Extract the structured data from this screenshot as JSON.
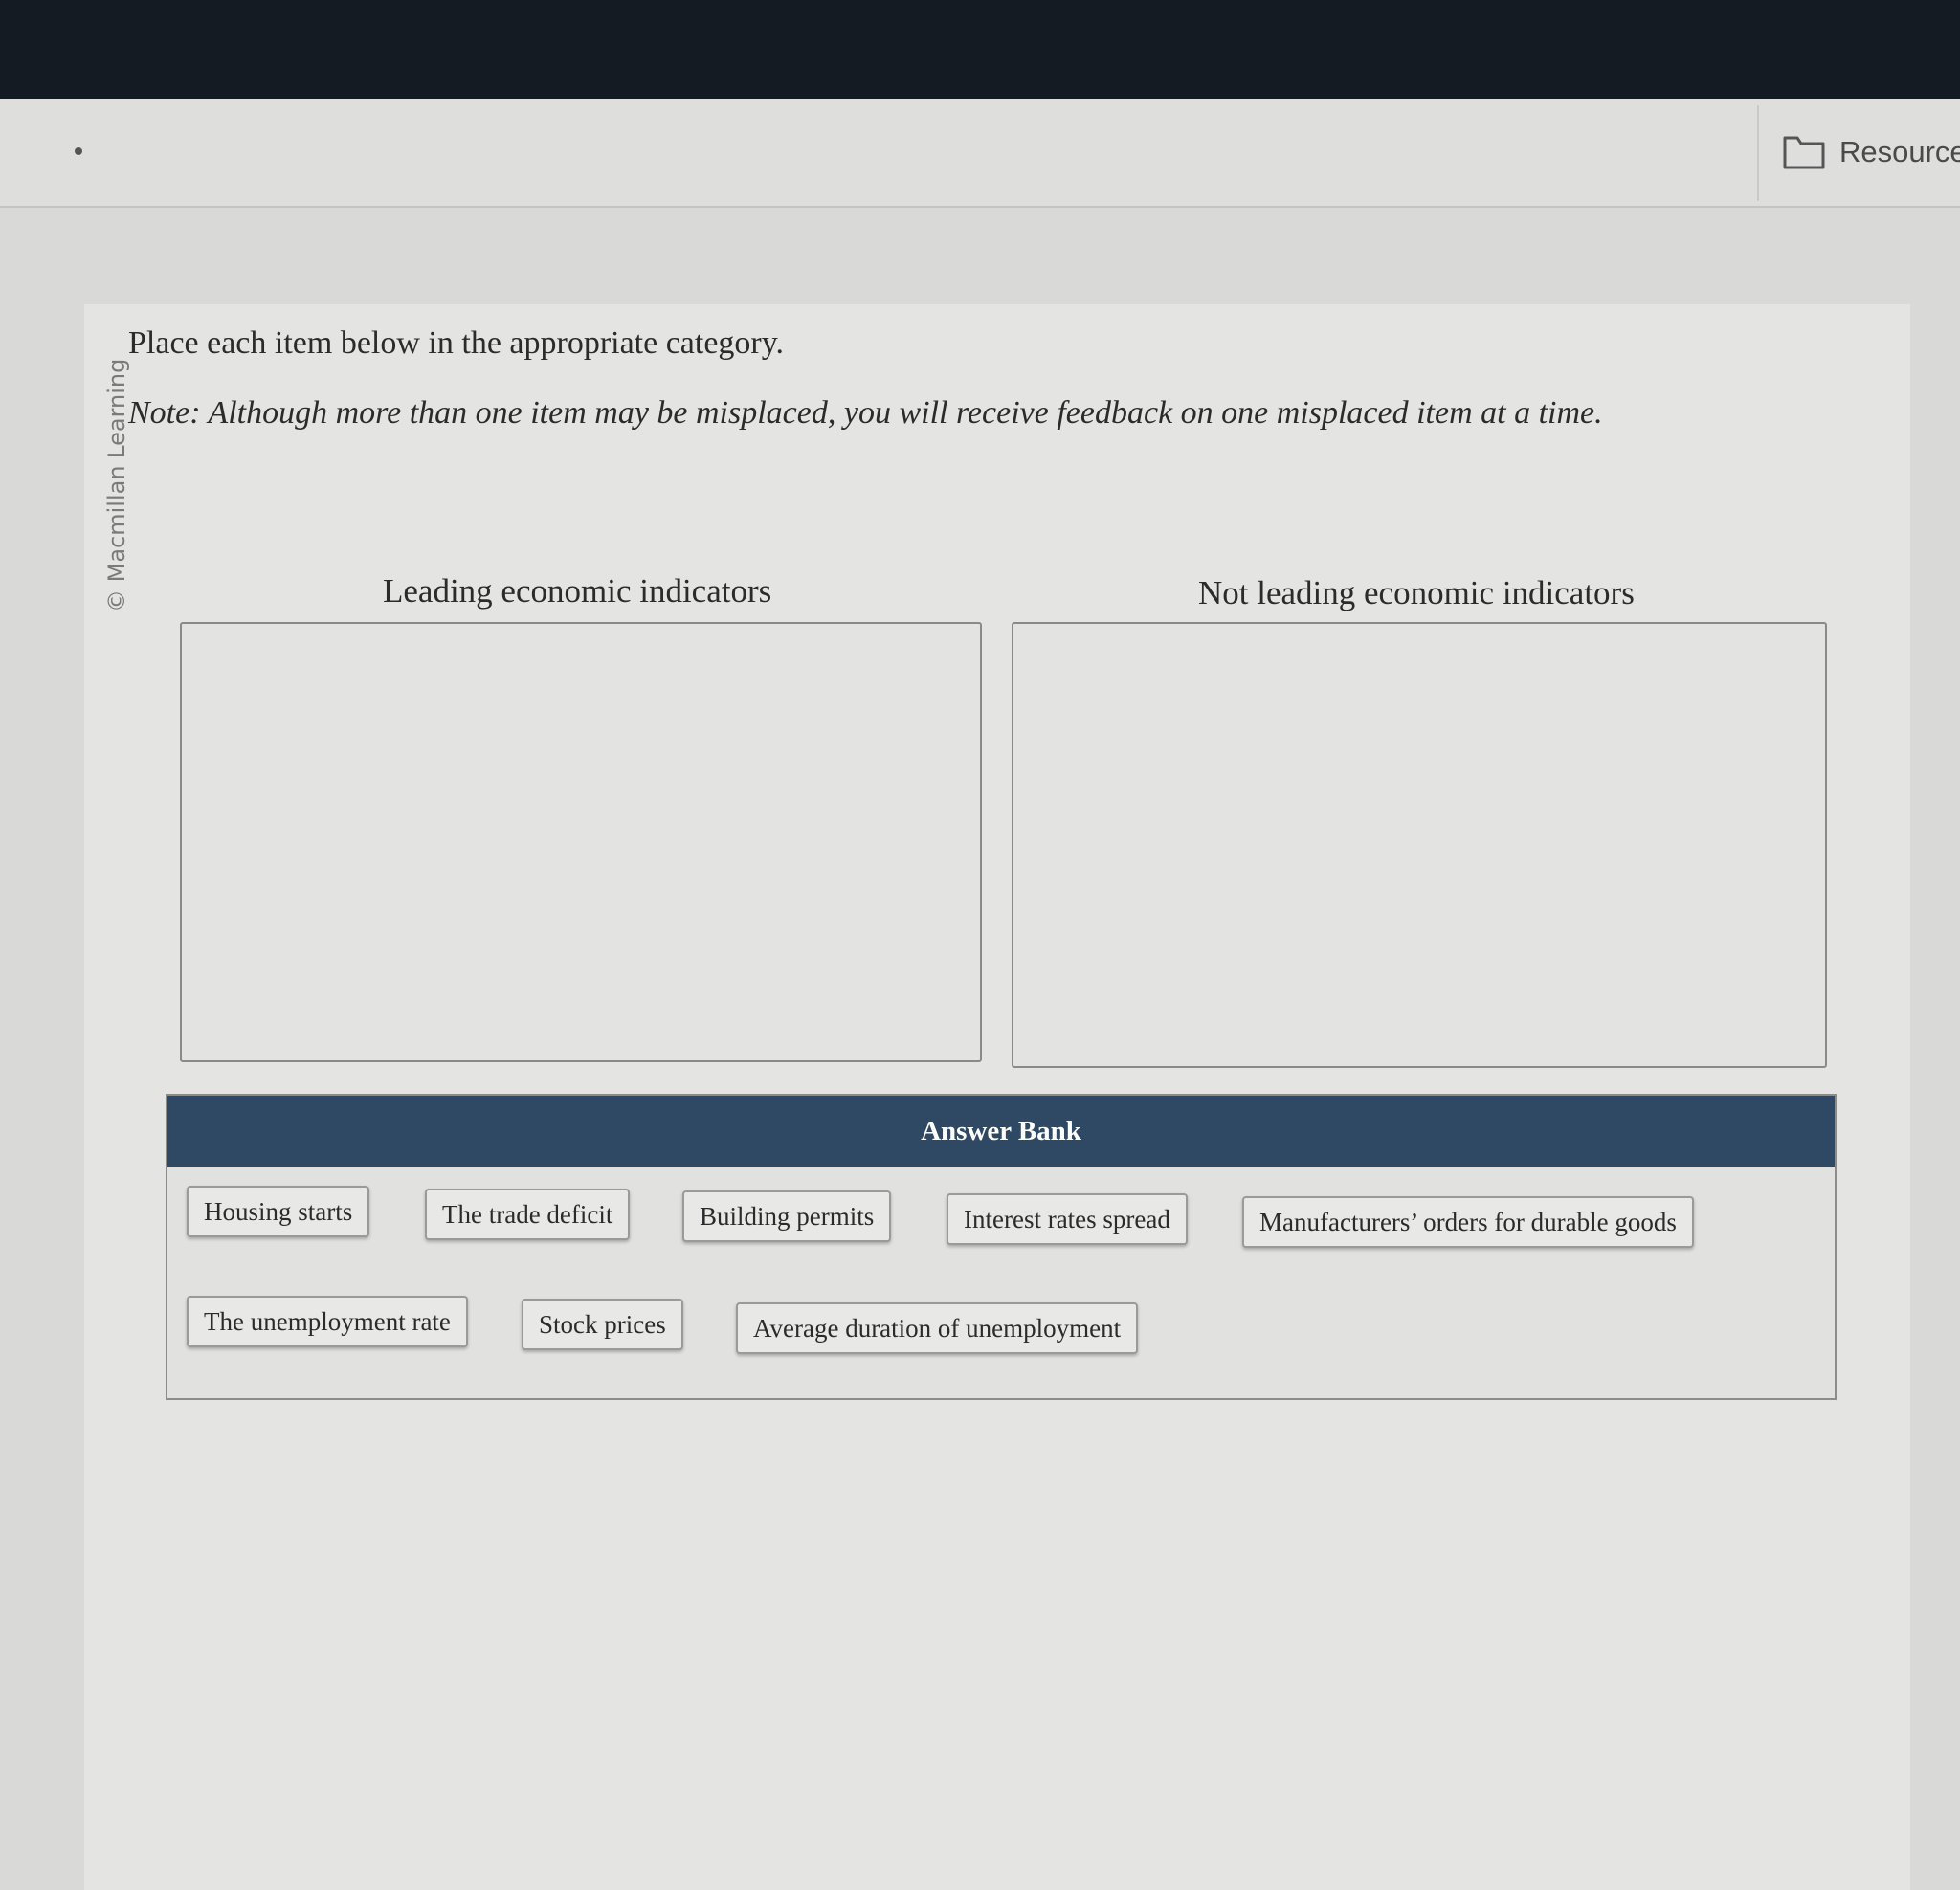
{
  "header": {
    "resources_label": "Resources"
  },
  "sidebar": {
    "copyright": "© Macmillan Learning"
  },
  "question": {
    "instruction": "Place each item below in the appropriate category.",
    "note": "Note: Although more than one item may be misplaced, you will receive feedback on one misplaced item at a time."
  },
  "categories": [
    {
      "label": "Leading economic indicators"
    },
    {
      "label": "Not leading economic indicators"
    }
  ],
  "answer_bank": {
    "title": "Answer Bank",
    "items": [
      "Housing starts",
      "The trade deficit",
      "Building permits",
      "Interest rates spread",
      "Manufacturers’ orders for durable goods",
      "The unemployment rate",
      "Stock prices",
      "Average duration of unemployment"
    ]
  },
  "colors": {
    "bank_header": "#2f4864",
    "top_bezel": "#141b22"
  }
}
